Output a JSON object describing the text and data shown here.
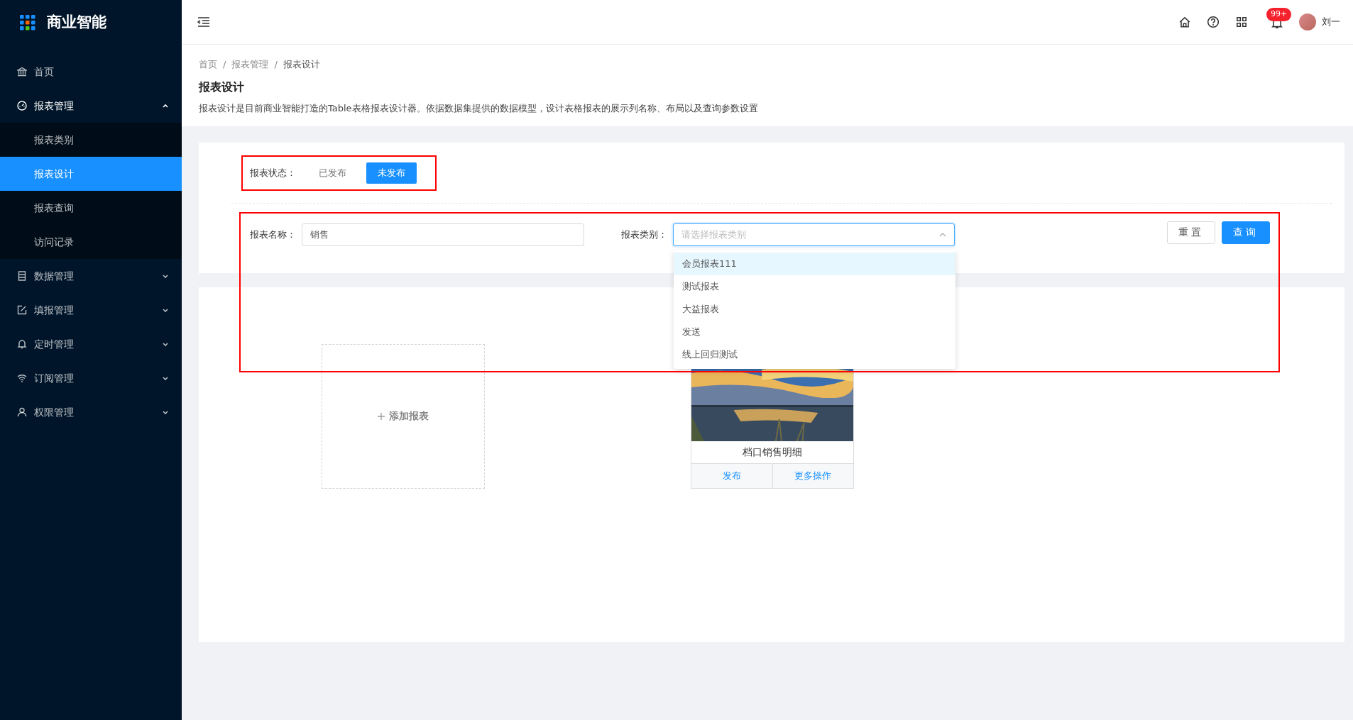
{
  "app": {
    "title": "商业智能"
  },
  "sidebar": {
    "items": [
      {
        "label": "首页",
        "kind": "link",
        "selected": false
      },
      {
        "label": "报表管理",
        "kind": "group",
        "expanded": true,
        "children": [
          {
            "label": "报表类别",
            "selected": false
          },
          {
            "label": "报表设计",
            "selected": true
          },
          {
            "label": "报表查询",
            "selected": false
          },
          {
            "label": "访问记录",
            "selected": false
          }
        ]
      },
      {
        "label": "数据管理",
        "kind": "group",
        "expanded": false
      },
      {
        "label": "填报管理",
        "kind": "group",
        "expanded": false
      },
      {
        "label": "定时管理",
        "kind": "group",
        "expanded": false
      },
      {
        "label": "订阅管理",
        "kind": "group",
        "expanded": false
      },
      {
        "label": "权限管理",
        "kind": "group",
        "expanded": false
      }
    ]
  },
  "header": {
    "notification_badge": "99+",
    "user_name": "刘一"
  },
  "breadcrumb": {
    "items": [
      "首页",
      "报表管理",
      "报表设计"
    ],
    "separators": [
      "/",
      "/"
    ]
  },
  "page": {
    "title": "报表设计",
    "description": "报表设计是目前商业智能打造的Table表格报表设计器。依据数据集提供的数据模型，设计表格报表的展示列名称、布局以及查询参数设置"
  },
  "filters": {
    "status": {
      "label": "报表状态：",
      "options": [
        {
          "label": "已发布",
          "selected": false
        },
        {
          "label": "未发布",
          "selected": true
        }
      ]
    },
    "name": {
      "label": "报表名称：",
      "value": "销售"
    },
    "category": {
      "label": "报表类别：",
      "placeholder": "请选择报表类别",
      "expanded": true,
      "options": [
        {
          "label": "会员报表111",
          "selected": true
        },
        {
          "label": "测试报表",
          "selected": false
        },
        {
          "label": "大益报表",
          "selected": false
        },
        {
          "label": "发送",
          "selected": false
        },
        {
          "label": "线上回归测试",
          "selected": false
        }
      ]
    },
    "buttons": [
      {
        "label": "重置",
        "primary": false
      },
      {
        "label": "查询",
        "primary": true
      }
    ]
  },
  "reports": {
    "add_label": "添加报表",
    "cards": [
      {
        "title": "档口销售明细",
        "kind": "picture",
        "actions": [
          "发布",
          "更多操作"
        ]
      }
    ]
  }
}
